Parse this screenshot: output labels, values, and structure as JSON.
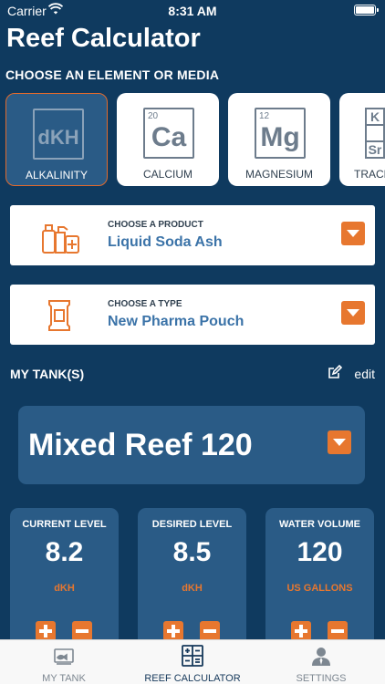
{
  "status": {
    "carrier": "Carrier",
    "time": "8:31 AM"
  },
  "title": "Reef Calculator",
  "choose_label": "CHOOSE AN ELEMENT OR MEDIA",
  "elements": [
    {
      "number": "",
      "symbol": "dKH",
      "name": "ALKALINITY",
      "selected": true
    },
    {
      "number": "20",
      "symbol": "Ca",
      "name": "CALCIUM",
      "selected": false
    },
    {
      "number": "12",
      "symbol": "Mg",
      "name": "MAGNESIUM",
      "selected": false
    },
    {
      "number": "",
      "symbol": "K Sr",
      "name": "TRACE E",
      "selected": false
    }
  ],
  "product": {
    "label": "CHOOSE A PRODUCT",
    "value": "Liquid Soda Ash",
    "icon": "product-bottles-icon"
  },
  "type": {
    "label": "CHOOSE A TYPE",
    "value": "New Pharma Pouch",
    "icon": "pouch-icon"
  },
  "tanks": {
    "label": "MY TANK(S)",
    "edit_label": "edit",
    "selected_tank": "Mixed Reef 120"
  },
  "levels": [
    {
      "label": "CURRENT LEVEL",
      "value": "8.2",
      "unit": "dKH"
    },
    {
      "label": "DESIRED LEVEL",
      "value": "8.5",
      "unit": "dKH"
    },
    {
      "label": "WATER VOLUME",
      "value": "120",
      "unit": "US GALLONS"
    }
  ],
  "tabs": [
    {
      "label": "MY TANK",
      "icon": "tank-icon",
      "active": false
    },
    {
      "label": "REEF CALCULATOR",
      "icon": "calculator-icon",
      "active": true
    },
    {
      "label": "SETTINGS",
      "icon": "person-icon",
      "active": false
    }
  ],
  "colors": {
    "background": "#0f3a5f",
    "card": "#2a5b86",
    "accent": "#e7772f",
    "link": "#3b73a8"
  }
}
